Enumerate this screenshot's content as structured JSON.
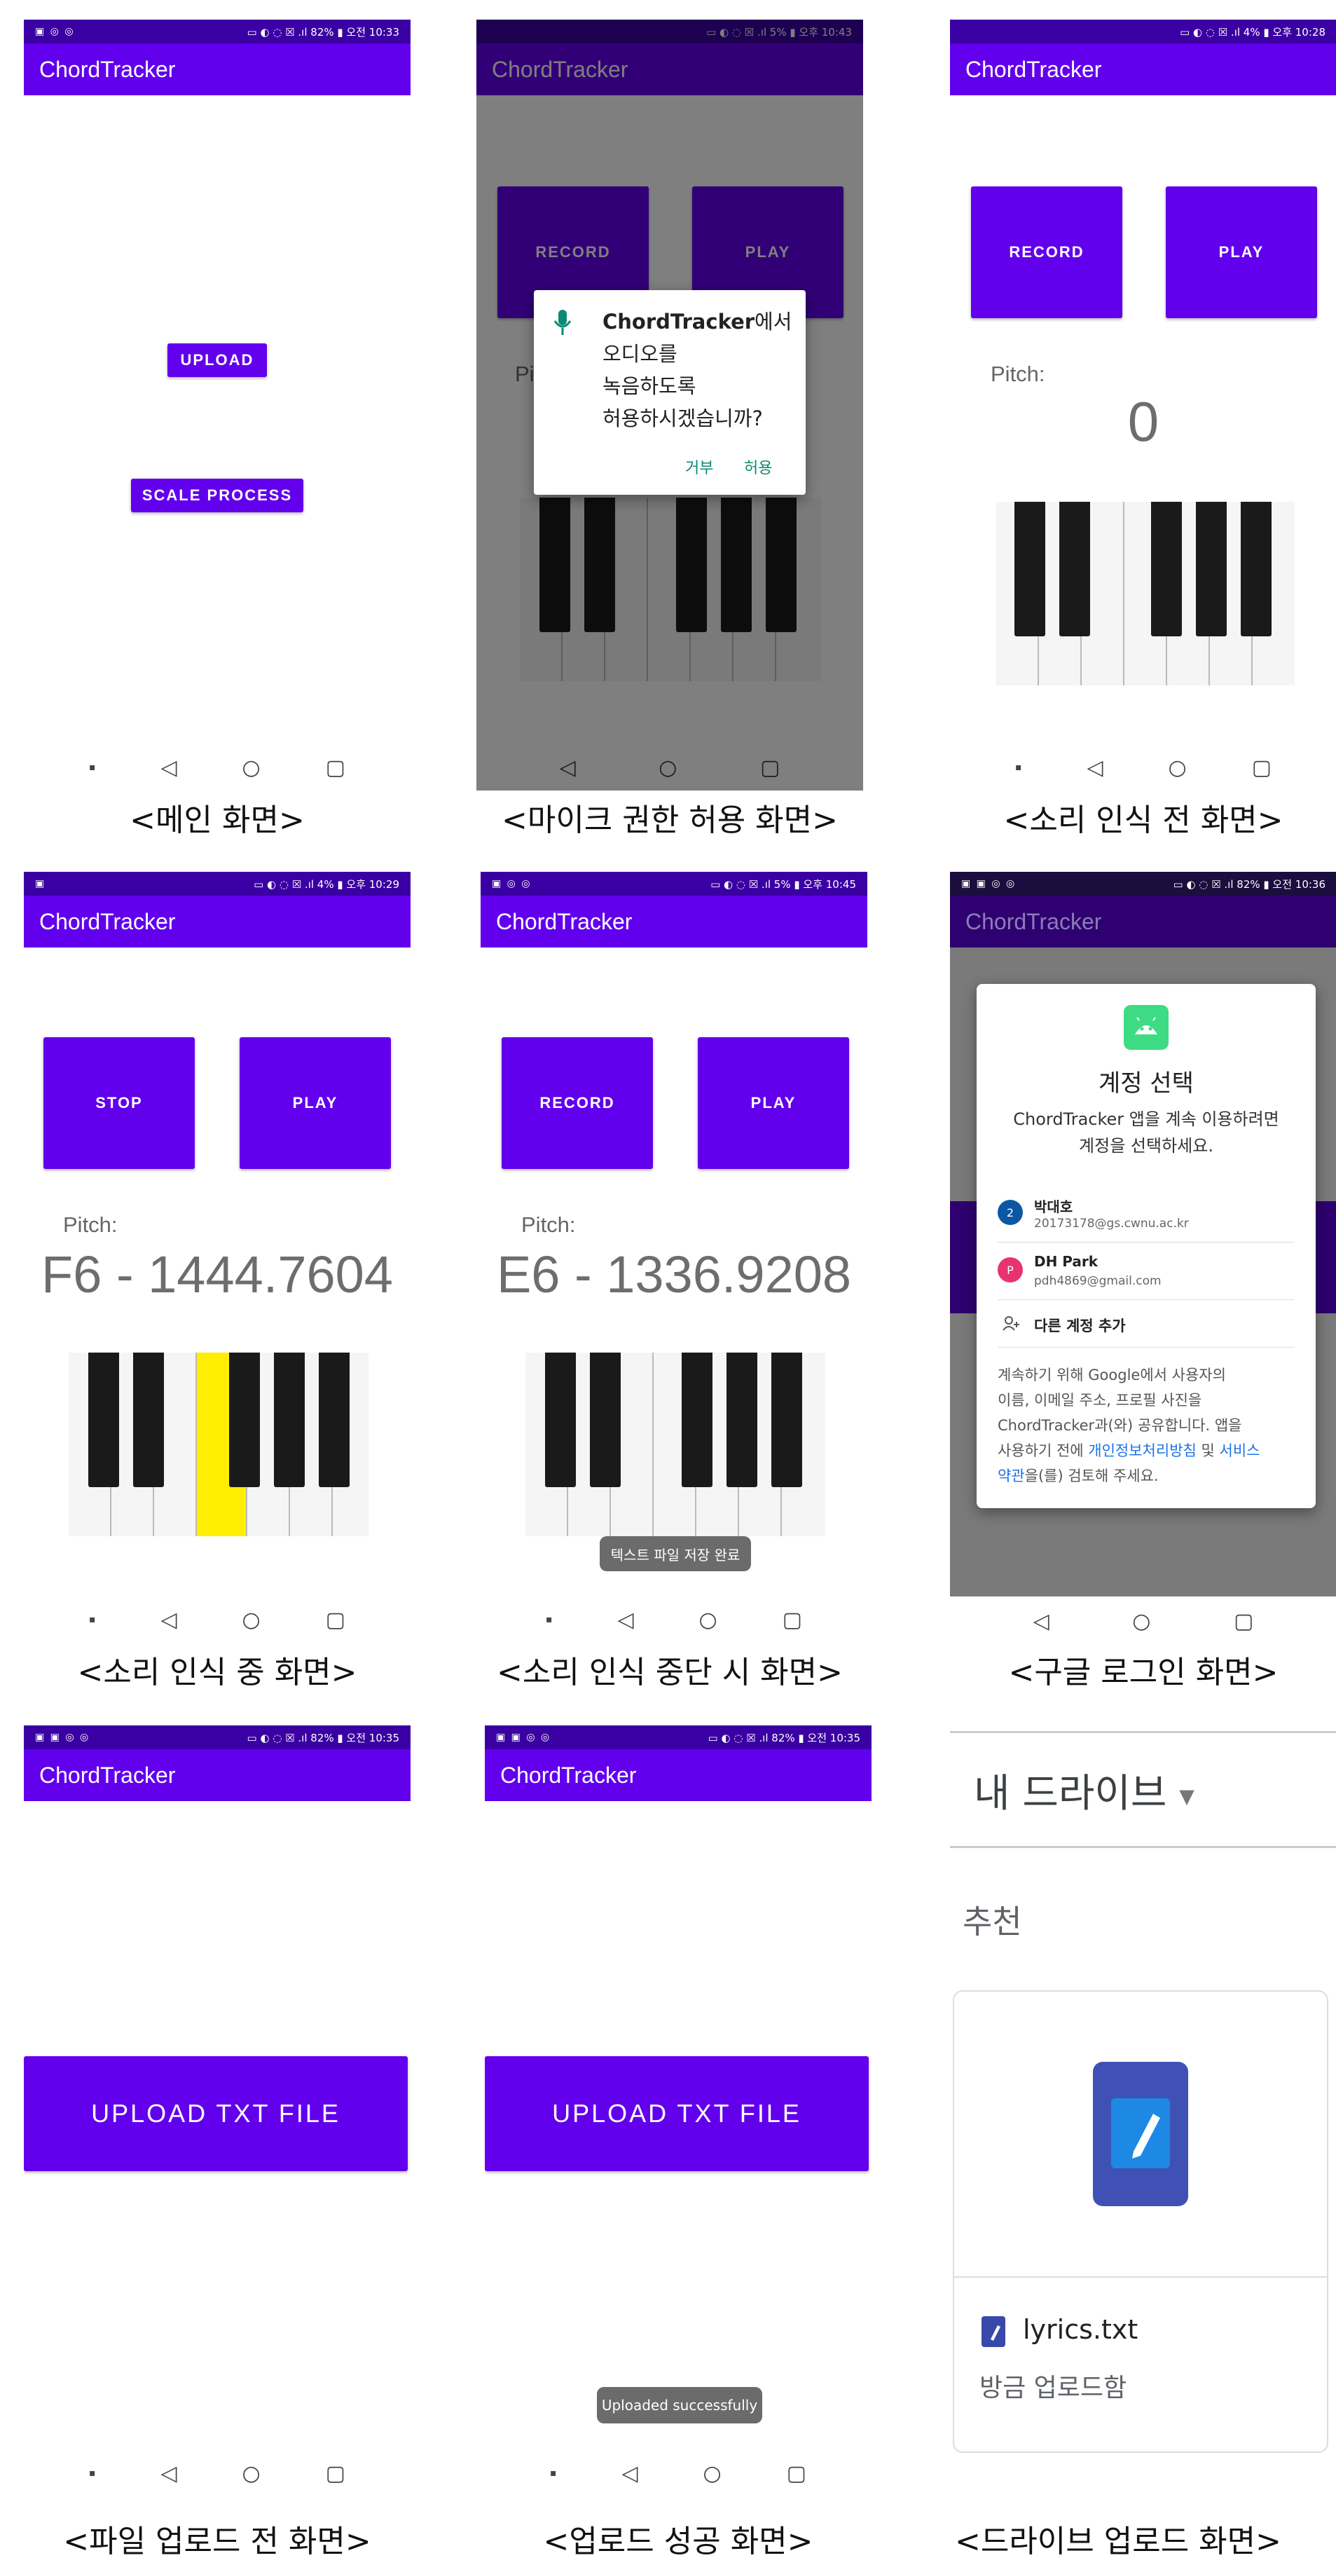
{
  "app_title": "ChordTracker",
  "status": {
    "main": {
      "left": "▣ ◎ ◎",
      "right": "▭ ◐ ◌ ☒ .ıl 82% ▮ 오전 10:33"
    },
    "perm": {
      "left": "",
      "right": "▭ ◐ ◌ ☒ .ıl 5% ▮ 오후 10:43"
    },
    "before": {
      "left": "",
      "right": "▭ ◐ ◌ ☒ .ıl 4% ▮ 오후 10:28"
    },
    "during": {
      "left": "▣",
      "right": "▭ ◐ ◌ ☒ .ıl 4% ▮ 오후 10:29"
    },
    "stopped": {
      "left": "▣ ◎ ◎",
      "right": "▭ ◐ ◌ ☒ .ıl 5% ▮ 오후 10:45"
    },
    "google": {
      "left": "▣ ▣ ◎ ◎",
      "right": "▭ ◐ ◌ ☒ .ıl 82% ▮ 오전 10:36"
    },
    "pre_upload": {
      "left": "▣ ▣ ◎ ◎",
      "right": "▭ ◐ ◌ ☒ .ıl 82% ▮ 오전 10:35"
    },
    "uploaded": {
      "left": "▣ ▣ ◎ ◎",
      "right": "▭ ◐ ◌ ☒ .ıl 82% ▮ 오전 10:35"
    }
  },
  "main": {
    "upload": "UPLOAD",
    "scale_process": "SCALE PROCESS"
  },
  "buttons": {
    "record": "RECORD",
    "play": "PLAY",
    "stop": "STOP",
    "upload_txt": "UPLOAD TXT FILE"
  },
  "pitch_label": "Pitch:",
  "pitch_values": {
    "before": "0",
    "during": "F6 - 1444.7604",
    "stopped": "E6 - 1336.9208"
  },
  "permission_dialog": {
    "app": "ChordTracker",
    "line1": "에서",
    "line2": "오디오를",
    "line3": "녹음하도록",
    "line4": "허용하시겠습니까?",
    "deny": "거부",
    "allow": "허용"
  },
  "partial_pitch": "Pi",
  "toasts": {
    "saved": "텍스트 파일 저장 완료",
    "uploaded": "Uploaded successfully"
  },
  "google_dialog": {
    "title": "계정 선택",
    "subtitle_1": "ChordTracker 앱을 계속 이용하려면",
    "subtitle_2": "계정을 선택하세요.",
    "accounts": [
      {
        "initial": "2",
        "name": "박대호",
        "email": "20173178@gs.cwnu.ac.kr",
        "color": "#0b57a4"
      },
      {
        "initial": "P",
        "name": "DH Park",
        "email": "pdh4869@gmail.com",
        "color": "#e8336e"
      }
    ],
    "add_account": "다른 계정 추가",
    "notice_1": "계속하기 위해 Google에서 사용자의",
    "notice_2": "이름, 이메일 주소, 프로필 사진을",
    "notice_3": "ChordTracker과(와) 공유합니다. 앱을",
    "notice_4": "사용하기 전에 ",
    "notice_link1": "개인정보처리방침",
    "notice_5": " 및 ",
    "notice_link2": "서비스",
    "notice_link3": "약관",
    "notice_6": "을(를) 검토해 주세요."
  },
  "drive": {
    "title": "내 드라이브",
    "section": "추천",
    "file_name": "lyrics.txt",
    "file_meta": "방금 업로드함"
  },
  "captions": {
    "main": "<메인 화면>",
    "perm": "<마이크 권한 허용 화면>",
    "before": "<소리 인식 전 화면>",
    "during": "<소리 인식 중 화면>",
    "stopped": "<소리 인식 중단 시 화면>",
    "google": "<구글 로그인 화면>",
    "pre_upload": "<파일 업로드 전 화면>",
    "uploaded": "<업로드 성공 화면>",
    "drive": "<드라이브 업로드 화면>"
  },
  "nav": {
    "dot": "▪",
    "back": "◁",
    "home": "○",
    "recent": "▢"
  },
  "colors": {
    "primary": "#6200ee",
    "status": "#3b00a3",
    "highlight": "#ffee00"
  }
}
